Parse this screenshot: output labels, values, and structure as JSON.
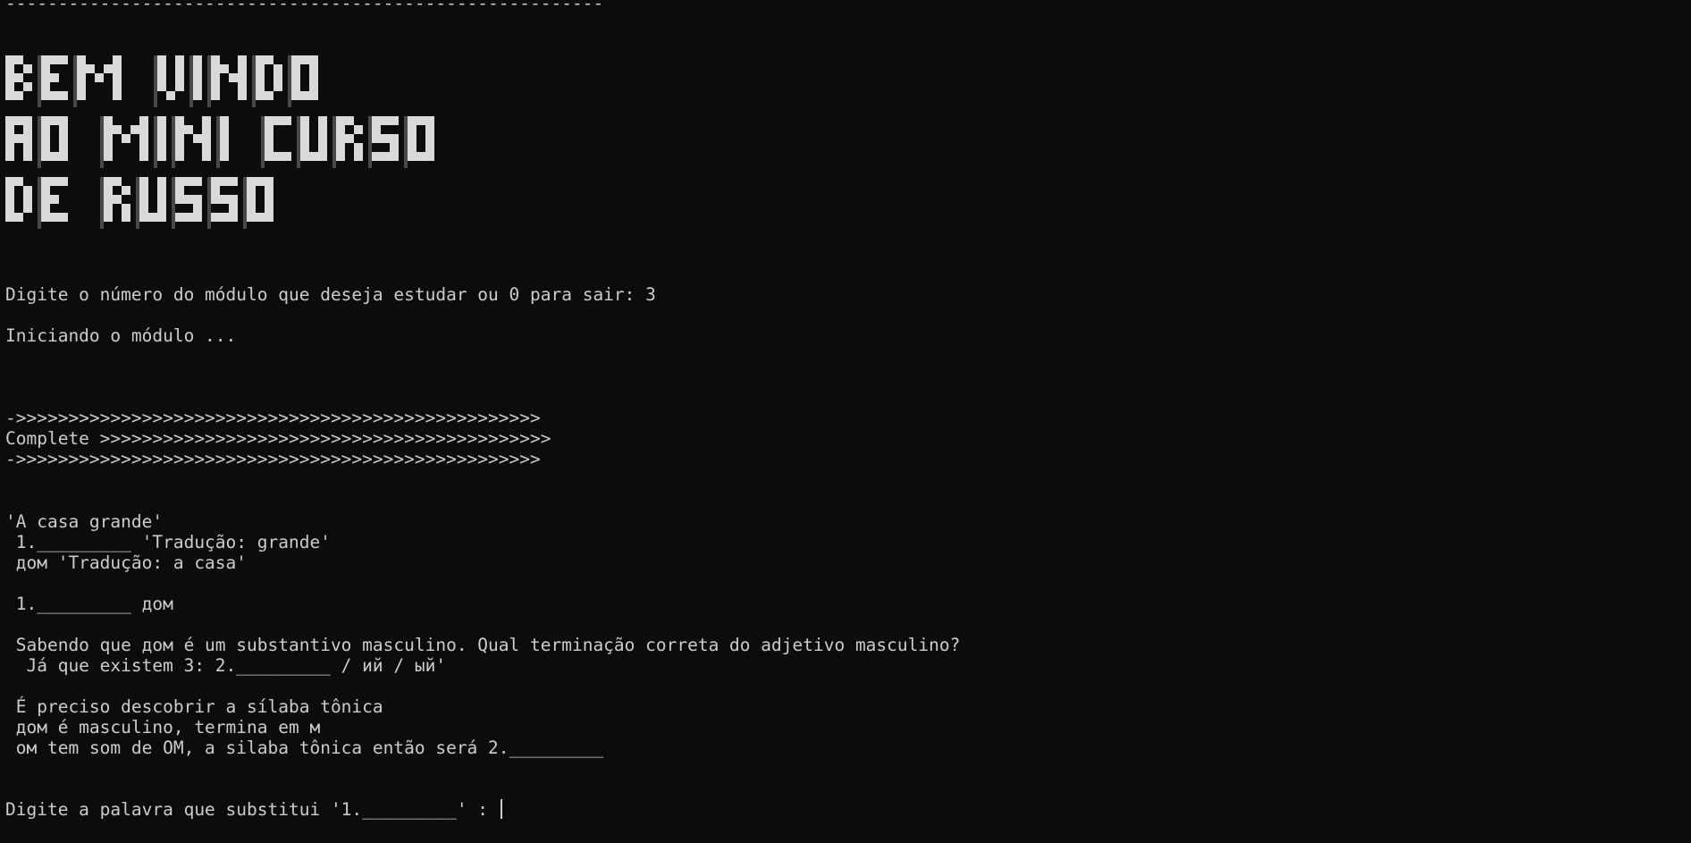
{
  "terminal": {
    "top_rule": "---------------------------------------------------------",
    "banner": {
      "lines": [
        "BEM VINDO",
        "AO MINI CURSO",
        "DE RUSSO"
      ],
      "fg_color": "#d9d9d9",
      "shade_color": "#7a7a7a"
    },
    "prompt_module": "Digite o número do módulo que deseja estudar ou 0 para sair: 3",
    "starting": "Iniciando o módulo ...",
    "arrow_rule_1": "->>>>>>>>>>>>>>>>>>>>>>>>>>>>>>>>>>>>>>>>>>>>>>>>>>",
    "complete_line": "Complete >>>>>>>>>>>>>>>>>>>>>>>>>>>>>>>>>>>>>>>>>>>",
    "arrow_rule_2": "->>>>>>>>>>>>>>>>>>>>>>>>>>>>>>>>>>>>>>>>>>>>>>>>>>",
    "sentence": "'A casa grande'",
    "blank1_line": " 1._________ 'Tradução: grande'",
    "noun_line": " дом 'Tradução: a casa'",
    "exercise_line": " 1._________ дом",
    "hint_1": " Sabendo que дом é um substantivo masculino. Qual terminação correta do adjetivo masculino?",
    "hint_2": "  Já que existem 3: 2._________ / ий / ый'",
    "stress_1": " É preciso descobrir a sílaba tônica",
    "stress_2": " дом é masculino, termina em м",
    "stress_3": " ом tem som de OM, a silaba tônica então será 2._________",
    "input_prompt": "Digite a palavra que substitui '1._________' : ",
    "colors": {
      "background": "#0c0c0c",
      "text": "#cccccc"
    }
  }
}
